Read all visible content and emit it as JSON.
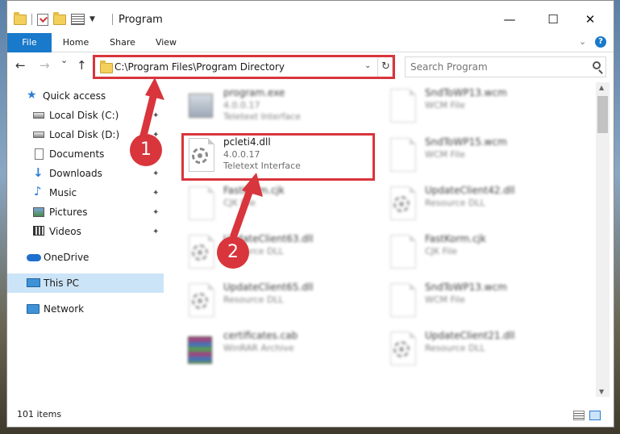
{
  "window": {
    "title": "Program",
    "minimize": "—",
    "maximize": "☐",
    "close": "✕"
  },
  "ribbon": {
    "tabs": [
      "File",
      "Home",
      "Share",
      "View"
    ],
    "help": "?"
  },
  "nav": {
    "back": "←",
    "forward": "→",
    "recent": "⌄",
    "up": "↑",
    "address": "C:\\Program Files\\Program Directory",
    "address_dropdown": "⌄",
    "refresh": "↻",
    "search_placeholder": "Search Program"
  },
  "sidebar": {
    "items": [
      {
        "label": "Quick access"
      },
      {
        "label": "Local Disk (C:)",
        "pinned": true
      },
      {
        "label": "Local Disk (D:)",
        "pinned": true
      },
      {
        "label": "Documents",
        "pinned": true
      },
      {
        "label": "Downloads",
        "pinned": true
      },
      {
        "label": "Music",
        "pinned": true
      },
      {
        "label": "Pictures",
        "pinned": true
      },
      {
        "label": "Videos",
        "pinned": true
      },
      {
        "label": "OneDrive"
      },
      {
        "label": "This PC",
        "selected": true
      },
      {
        "label": "Network"
      }
    ],
    "pin_glyph": "✦"
  },
  "files": {
    "left": [
      {
        "name": "program.exe",
        "line1": "4.0.0.17",
        "line2": "Teletext Interface",
        "icon": "exe-icon"
      },
      {
        "name": "pcleti4.dll",
        "line1": "4.0.0.17",
        "line2": "Teletext Interface",
        "icon": "gear-icon",
        "highlighted": true
      },
      {
        "name": "FastKorm.cjk",
        "line1": "CJK File",
        "line2": "",
        "icon": "blank-file-icon"
      },
      {
        "name": "UpdateClient63.dll",
        "line1": "Resource DLL",
        "line2": "",
        "icon": "gear-icon"
      },
      {
        "name": "UpdateClient65.dll",
        "line1": "Resource DLL",
        "line2": "",
        "icon": "gear-icon"
      },
      {
        "name": "certificates.cab",
        "line1": "WinRAR Archive",
        "line2": "",
        "icon": "archive-icon"
      }
    ],
    "right": [
      {
        "name": "SndToWP13.wcm",
        "line1": "WCM File",
        "line2": "",
        "icon": "blank-file-icon"
      },
      {
        "name": "SndToWP15.wcm",
        "line1": "WCM File",
        "line2": "",
        "icon": "blank-file-icon"
      },
      {
        "name": "UpdateClient42.dll",
        "line1": "Resource DLL",
        "line2": "",
        "icon": "gear-icon"
      },
      {
        "name": "FastKorm.cjk",
        "line1": "CJK File",
        "line2": "",
        "icon": "blank-file-icon"
      },
      {
        "name": "SndToWP13.wcm",
        "line1": "WCM File",
        "line2": "",
        "icon": "blank-file-icon"
      },
      {
        "name": "UpdateClient21.dll",
        "line1": "Resource DLL",
        "line2": "",
        "icon": "gear-icon"
      }
    ]
  },
  "status": {
    "item_count": "101 items"
  },
  "annotations": {
    "badge1": "1",
    "badge2": "2",
    "highlight_color": "#d9353c"
  },
  "colors": {
    "accent": "#1979ca",
    "selection": "#cce4f7"
  }
}
